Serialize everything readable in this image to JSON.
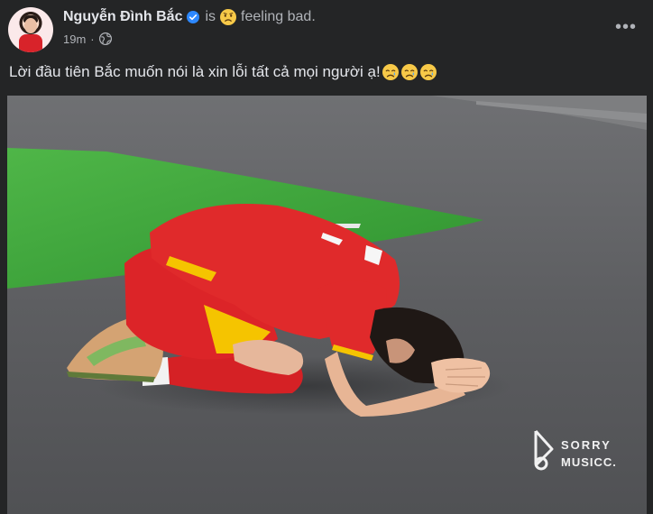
{
  "post": {
    "author": "Nguyễn Đình Bắc",
    "activity_prefix": "is",
    "feeling": "feeling bad.",
    "timestamp": "19m",
    "separator": "·",
    "privacy_icon": "globe-icon",
    "more_label": "•••",
    "caption": "Lời đầu tiên Bắc muốn nói là xin lỗi tất cả mọi người ạ!",
    "caption_emojis": [
      "crying-face",
      "crying-face",
      "crying-face"
    ],
    "feeling_emoji": "worried-face",
    "verified_icon": "verified-badge-icon",
    "photo": {
      "description": "player-kneeling-photo",
      "watermark_line1": "SORRY",
      "watermark_line2": "MUSICC."
    }
  },
  "colors": {
    "background": "#242526",
    "text_primary": "#e4e6eb",
    "text_secondary": "#b0b3b8",
    "verified_blue": "#2d88ff",
    "jersey_red": "#d8232a",
    "turf_green": "#3aa53a"
  }
}
